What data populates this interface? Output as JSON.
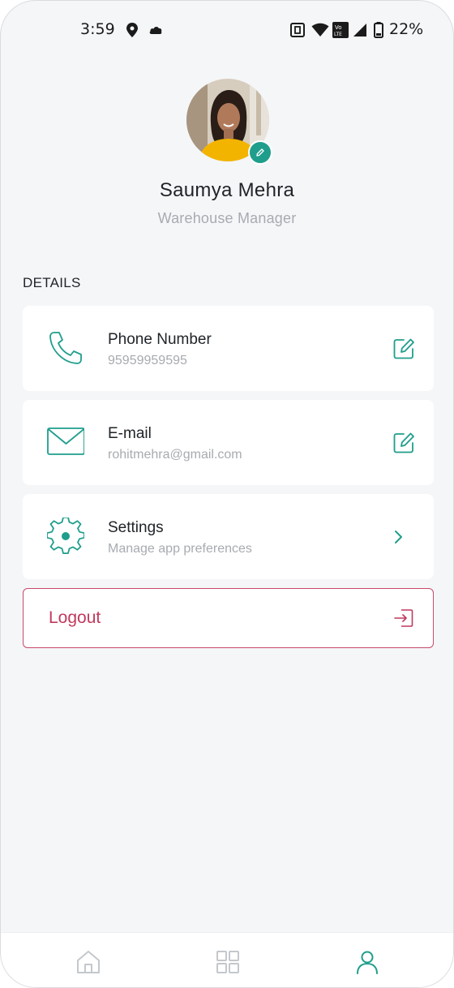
{
  "status_bar": {
    "time": "3:59",
    "battery": "22%",
    "icons": [
      "location-icon",
      "weather-icon",
      "nfc-icon",
      "wifi-icon",
      "volte-icon",
      "signal-icon",
      "battery-icon"
    ]
  },
  "profile": {
    "name": "Saumya Mehra",
    "role": "Warehouse Manager",
    "avatar_icon": "profile-photo",
    "edit_icon": "pencil-icon"
  },
  "details": {
    "section_title": "DETAILS",
    "items": [
      {
        "title": "Phone Number",
        "subtitle": "95959959595",
        "icon": "phone-icon",
        "action_icon": "edit-icon"
      },
      {
        "title": "E-mail",
        "subtitle": "rohitmehra@gmail.com",
        "icon": "mail-icon",
        "action_icon": "edit-icon"
      },
      {
        "title": "Settings",
        "subtitle": "Manage app preferences",
        "icon": "gear-icon",
        "action_icon": "chevron-right-icon"
      }
    ]
  },
  "logout": {
    "label": "Logout",
    "icon": "logout-icon"
  },
  "bottom_nav": {
    "items": [
      {
        "icon": "home-icon",
        "active": false
      },
      {
        "icon": "grid-icon",
        "active": false
      },
      {
        "icon": "user-icon",
        "active": true
      }
    ]
  },
  "colors": {
    "accent": "#1f9e8c",
    "danger": "#c0395e",
    "background": "#f5f6f8",
    "muted_text": "#a7abb0"
  }
}
